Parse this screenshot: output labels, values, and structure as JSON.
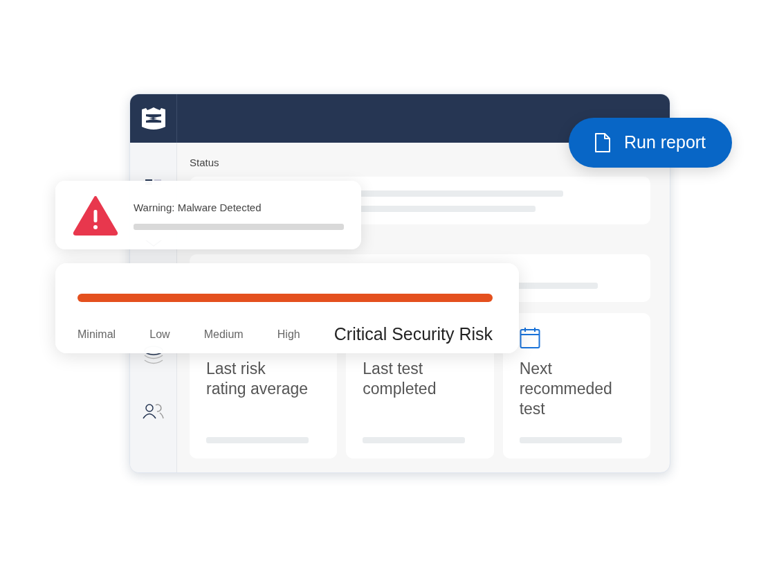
{
  "app": {
    "section_title": "Status"
  },
  "alert": {
    "title": "Warning: Malware Detected"
  },
  "risk": {
    "scale": [
      {
        "label": "Minimal",
        "selected": false
      },
      {
        "label": "Low",
        "selected": false
      },
      {
        "label": "Medium",
        "selected": false
      },
      {
        "label": "High",
        "selected": false
      },
      {
        "label": "Critical Security Risk",
        "selected": true
      }
    ]
  },
  "stats": [
    {
      "title": "Last risk\nrating average"
    },
    {
      "title": "Last test\ncompleted"
    },
    {
      "title": "Next\nrecommeded\ntest"
    }
  ],
  "run_button": {
    "label": "Run report"
  }
}
